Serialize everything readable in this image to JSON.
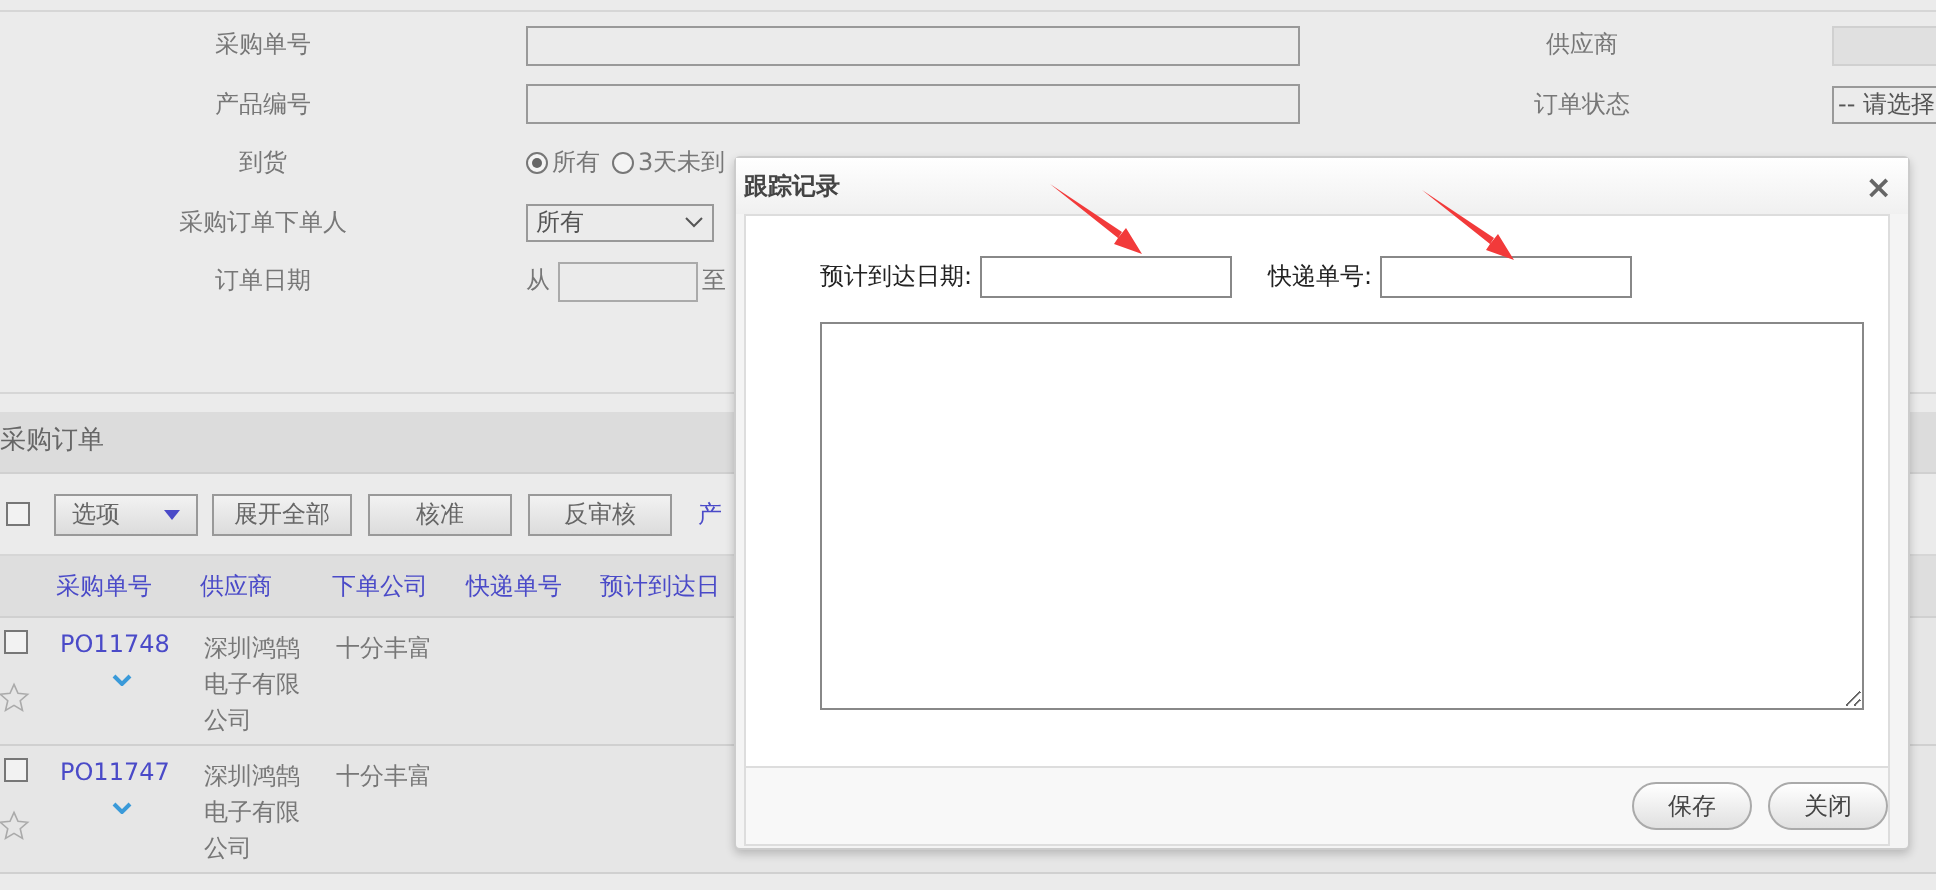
{
  "filters": {
    "left": [
      {
        "label": "采购单号",
        "kind": "text"
      },
      {
        "label": "产品编号",
        "kind": "text"
      },
      {
        "label": "到货",
        "kind": "radio",
        "options": [
          {
            "label": "所有",
            "selected": true
          },
          {
            "label": "3天未到",
            "selected": false
          }
        ]
      },
      {
        "label": "采购订单下单人",
        "kind": "select",
        "value": "所有"
      },
      {
        "label": "订单日期",
        "kind": "daterange",
        "from": "从",
        "to": "至"
      }
    ],
    "right": [
      {
        "label": "供应商",
        "kind": "readonly"
      },
      {
        "label": "订单状态",
        "kind": "select",
        "value": "-- 请选择"
      }
    ]
  },
  "section": {
    "title": "采购订单"
  },
  "toolbar": {
    "select_all": {
      "checked": false
    },
    "options": "选项",
    "buttons": [
      "展开全部",
      "核准",
      "反审核"
    ],
    "link": "产"
  },
  "table": {
    "columns": [
      "采购单号",
      "供应商",
      "下单公司",
      "快递单号",
      "预计到达日"
    ],
    "rows": [
      {
        "checked": false,
        "starred": false,
        "order": "PO11748",
        "supplier": "深圳鸿鹄电子有限公司",
        "company": "十分丰富"
      },
      {
        "checked": false,
        "starred": false,
        "order": "PO11747",
        "supplier": "深圳鸿鹄电子有限公司",
        "company": "十分丰富"
      }
    ]
  },
  "dialog": {
    "title": "跟踪记录",
    "close": "×",
    "fields": [
      {
        "label": "预计到达日期:"
      },
      {
        "label": "快递单号:"
      }
    ],
    "buttons": [
      "保存",
      "关闭"
    ]
  }
}
